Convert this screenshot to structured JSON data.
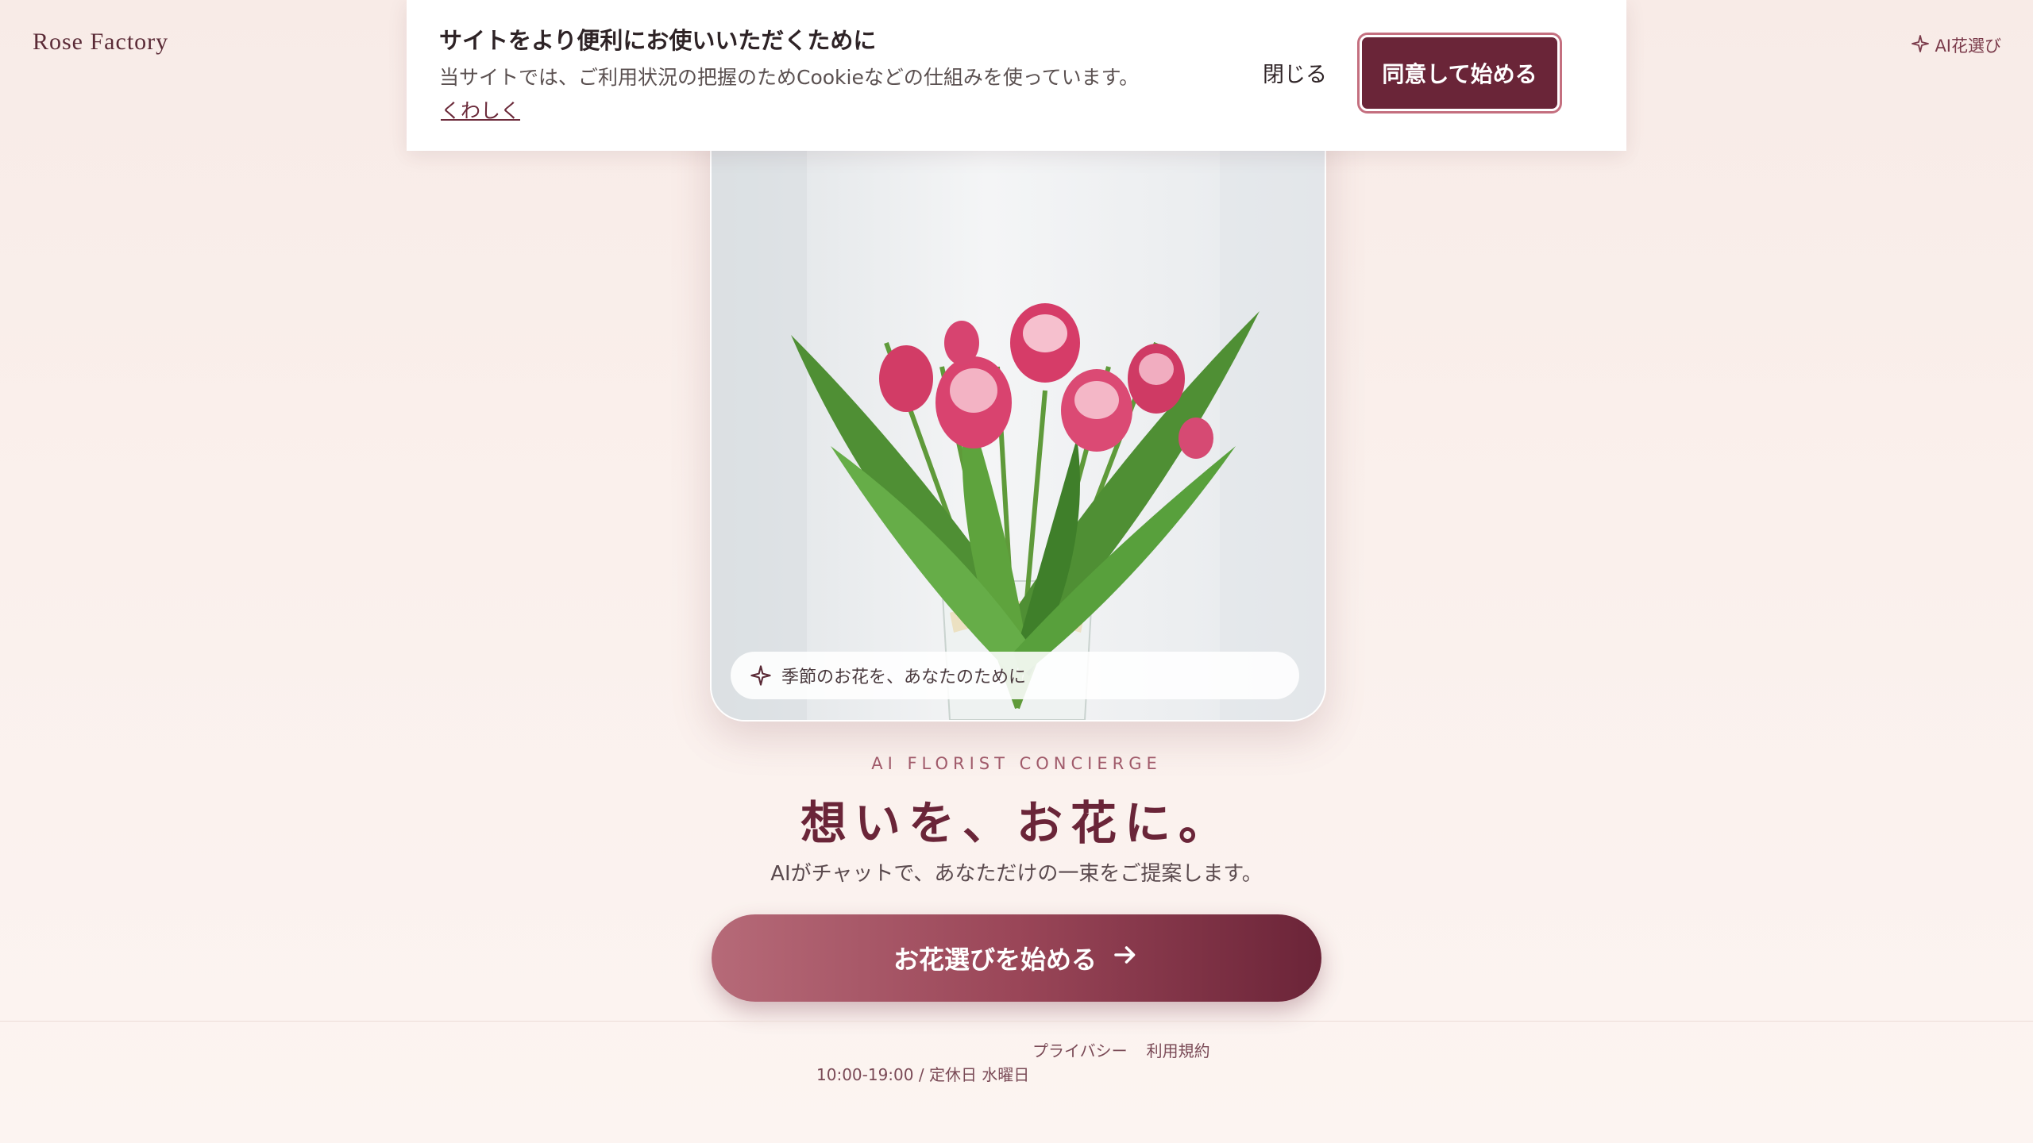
{
  "header": {
    "brand": "Rose Factory",
    "ai_link_label": "AI花選び"
  },
  "cookie_banner": {
    "title": "サイトをより便利にお使いいただくために",
    "text": "当サイトでは、ご利用状況の把握のためCookieなどの仕組みを使っています。",
    "more_link": "くわしく",
    "close_label": "閉じる",
    "accept_label": "同意して始める"
  },
  "hero": {
    "caption": "季節のお花を、あなたのために",
    "eyebrow": "AI FLORIST CONCIERGE",
    "headline": "想いを、お花に。",
    "subhead": "AIがチャットで、あなただけの一束をご提案します。",
    "cta_label": "お花選びを始める"
  },
  "footer": {
    "links": [
      "プライバシー",
      "利用規約"
    ],
    "hours": "10:00-19:00 / 定休日 水曜日"
  },
  "colors": {
    "accent": "#6a2538",
    "cta_start": "#b66a78",
    "cta_end": "#6b2438",
    "background": "#f8ebe7"
  },
  "icons": {
    "sparkle": "sparkle-icon",
    "arrow": "arrow-right-icon"
  }
}
